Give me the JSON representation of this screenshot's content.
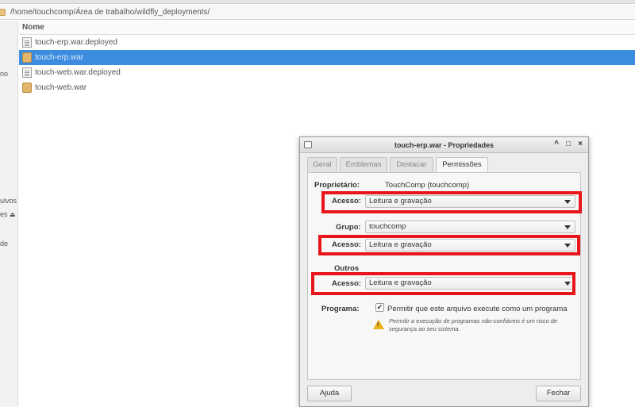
{
  "file_manager": {
    "path": "/home/touchcomp/Área de trabalho/wildfly_deployments/",
    "column_header": "Nome",
    "sidebar_fragments": [
      "no",
      "uivos",
      "es",
      "de"
    ],
    "files": [
      {
        "name": "touch-erp.war.deployed",
        "icon": "document-icon",
        "selected": false
      },
      {
        "name": "touch-erp.war",
        "icon": "package-icon",
        "selected": true
      },
      {
        "name": "touch-web.war.deployed",
        "icon": "document-icon",
        "selected": false
      },
      {
        "name": "touch-web.war",
        "icon": "package-icon",
        "selected": false
      }
    ]
  },
  "dialog": {
    "title": "touch-erp.war - Propriedades",
    "window_buttons": {
      "minimize": "^",
      "maximize": "□",
      "close": "×"
    },
    "tabs": [
      {
        "label": "Geral",
        "active": false
      },
      {
        "label": "Emblemas",
        "active": false
      },
      {
        "label": "Destacar",
        "active": false
      },
      {
        "label": "Permissões",
        "active": true
      }
    ],
    "owner_label": "Proprietário:",
    "owner_value": "TouchComp (touchcomp)",
    "owner_access_label": "Acesso:",
    "owner_access_value": "Leitura e gravação",
    "group_label": "Grupo:",
    "group_value": "touchcomp",
    "group_access_label": "Acesso:",
    "group_access_value": "Leitura e gravação",
    "others_label": "Outros",
    "others_access_label": "Acesso:",
    "others_access_value": "Leitura e gravação",
    "program_label": "Programa:",
    "program_checkbox_label": "Permitir que este arquivo execute como um programa",
    "program_checked": true,
    "check_glyph": "✔",
    "warning_mark": "!",
    "warning_text": "Permitir a execução de programas não-confiáveis é um risco de segurança ao seu sistema.",
    "help_button": "Ajuda",
    "close_button": "Fechar"
  },
  "colors": {
    "selection": "#3c8de0",
    "highlight_box": "#e8151b",
    "warning": "#e9b21a"
  }
}
